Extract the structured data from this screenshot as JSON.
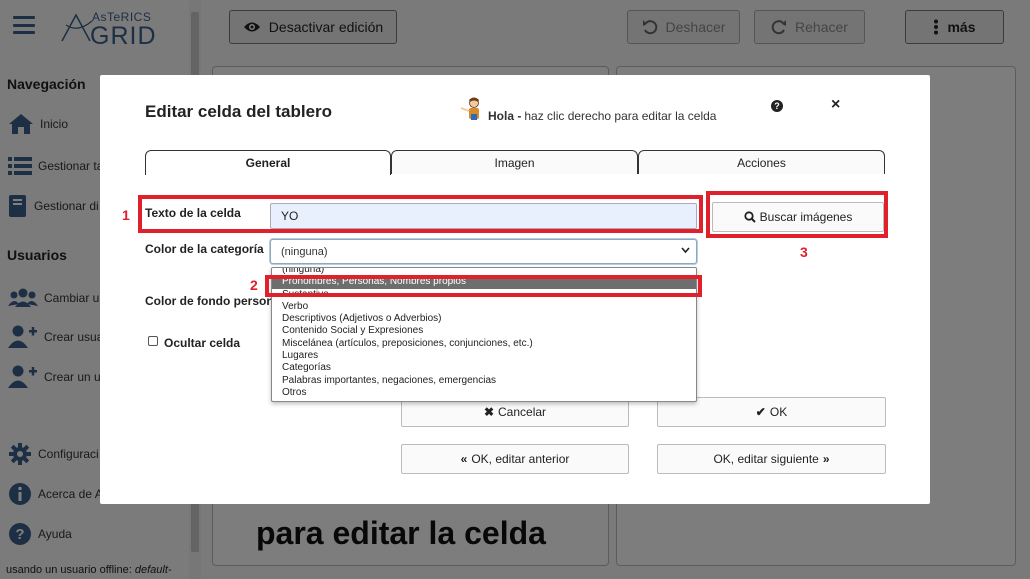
{
  "app": {
    "logo_top": "AsTeRICS",
    "logo_bottom": "GRID"
  },
  "sidebar": {
    "nav_heading": "Navegación",
    "nav_items": [
      {
        "label": "Inicio",
        "icon": "home-icon"
      },
      {
        "label": "Gestionar ta",
        "icon": "list-icon"
      },
      {
        "label": "Gestionar di",
        "icon": "book-icon"
      }
    ],
    "users_heading": "Usuarios",
    "user_items": [
      {
        "label": "Cambiar u",
        "icon": "users-icon"
      },
      {
        "label": "Crear usua",
        "icon": "user-plus-icon"
      },
      {
        "label": "Crear un u",
        "icon": "user-plus-icon"
      }
    ],
    "bottom_items": [
      {
        "label": "Configuraci",
        "icon": "gear-icon"
      },
      {
        "label": "Acerca de A",
        "icon": "info-icon"
      },
      {
        "label": "Ayuda",
        "icon": "question-icon"
      }
    ],
    "footer_prefix": "usando un usuario offline: ",
    "footer_user": "default-"
  },
  "toolbar": {
    "edit_toggle": "Desactivar edición",
    "undo": "Deshacer",
    "redo": "Rehacer",
    "more": "más"
  },
  "grid": {
    "visible_text": "para editar la celda"
  },
  "modal": {
    "title": "Editar celda del tablero",
    "hint_bold": "Hola -",
    "hint_text": "haz clic derecho para editar la celda",
    "help_glyph": "?",
    "close_glyph": "×",
    "tabs": [
      "General",
      "Imagen",
      "Acciones"
    ],
    "active_tab": "General",
    "label_text": "Texto de la celda",
    "text_value": "YO",
    "search_images": "Buscar imágenes",
    "label_category": "Color de la categoría",
    "category_value": "(ninguna)",
    "category_options": [
      "(ninguna)",
      "Pronombres, Personas, Nombres propios",
      "Sustantivo",
      "Verbo",
      "Descriptivos (Adjetivos o Adverbios)",
      "Contenido Social y Expresiones",
      "Miscelánea (artículos, preposiciones, conjunciones, etc.)",
      "Lugares",
      "Categorías",
      "Palabras importantes, negaciones, emergencias",
      "Otros"
    ],
    "selected_option_index": 1,
    "label_bg": "Color de fondo persona",
    "label_hide": "Ocultar celda",
    "cancel": "Cancelar",
    "ok": "OK",
    "ok_prev": "OK, editar anterior",
    "ok_next": "OK, editar siguiente"
  },
  "annotations": [
    "1",
    "2",
    "3"
  ],
  "colors": {
    "accent": "#3a5f8a",
    "annotation": "#e0202a",
    "selected_option": "#6e6e6e"
  }
}
